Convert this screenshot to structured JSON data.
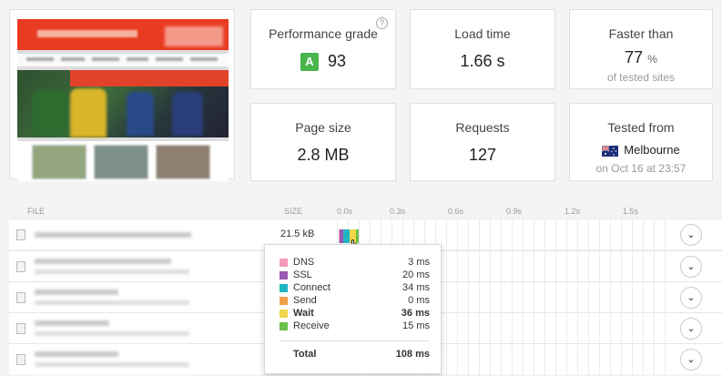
{
  "summary": {
    "performance": {
      "title": "Performance grade",
      "grade": "A",
      "score": "93",
      "help": "?"
    },
    "load_time": {
      "title": "Load time",
      "value": "1.66 s"
    },
    "faster_than": {
      "title": "Faster than",
      "value": "77",
      "unit": "%",
      "sub": "of tested sites"
    },
    "page_size": {
      "title": "Page size",
      "value": "2.8 MB"
    },
    "requests": {
      "title": "Requests",
      "value": "127"
    },
    "tested_from": {
      "title": "Tested from",
      "location": "Melbourne",
      "sub": "on Oct 16 at 23:57"
    }
  },
  "table": {
    "headers": {
      "file": "FILE",
      "size": "SIZE"
    },
    "ticks": [
      "0.0s",
      "0.3s",
      "0.6s",
      "0.9s",
      "1.2s",
      "1.5s"
    ],
    "rows": [
      {
        "size": "21.5 kB"
      }
    ]
  },
  "tooltip": {
    "items": [
      {
        "label": "DNS",
        "ms": "3 ms",
        "color": "#f29ab9"
      },
      {
        "label": "SSL",
        "ms": "20 ms",
        "color": "#9b59b6"
      },
      {
        "label": "Connect",
        "ms": "34 ms",
        "color": "#1fb6c1"
      },
      {
        "label": "Send",
        "ms": "0 ms",
        "color": "#f0a04b"
      },
      {
        "label": "Wait",
        "ms": "36 ms",
        "color": "#f3d74a"
      },
      {
        "label": "Receive",
        "ms": "15 ms",
        "color": "#6cbf4a"
      }
    ],
    "total_label": "Total",
    "total_ms": "108 ms"
  },
  "icons": {
    "expand": "chevron-down-icon",
    "file": "file-icon",
    "cursor": "hand-cursor-icon",
    "flag": "australia-flag-icon"
  }
}
